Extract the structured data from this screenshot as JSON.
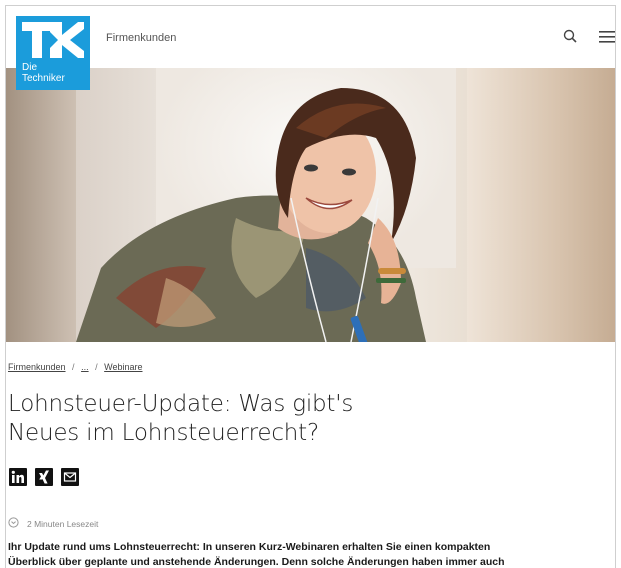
{
  "brand": {
    "logo_line1": "Die",
    "logo_line2": "Techniker",
    "color": "#1b9cdb"
  },
  "header": {
    "nav_label": "Firmenkunden"
  },
  "icons": {
    "search": "search-icon",
    "menu": "menu-icon",
    "linkedin": "linkedin-icon",
    "xing": "xing-icon",
    "mail": "mail-icon",
    "clock": "clock-icon"
  },
  "hero": {
    "description_alt": ""
  },
  "breadcrumb": {
    "item1": "Firmenkunden",
    "sep": "/",
    "ellipsis": "...",
    "item3": "Webinare"
  },
  "article": {
    "title_line1": "Lohnsteuer-Update: Was gibt's",
    "title_line2": "Neues im Lohnsteuerrecht?",
    "read_time": "2 Minuten Lesezeit",
    "intro_line1": "Ihr Update rund ums Lohnsteuerrecht: In unseren Kurz-Webinaren erhalten Sie einen kompakten",
    "intro_line2": "Überblick über geplante und anstehende Änderungen. Denn solche Änderungen haben immer auch"
  }
}
